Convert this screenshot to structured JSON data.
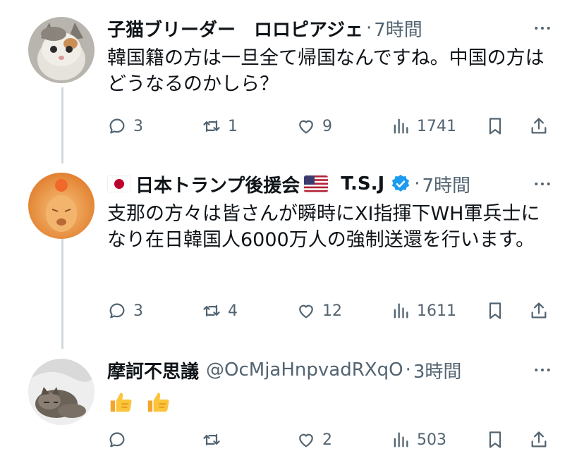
{
  "colors": {
    "muted": "#536471",
    "text": "#0f1419",
    "verified": "#1d9bf0",
    "line": "#cfd9de"
  },
  "tweets": [
    {
      "name": "子猫ブリーダー　ロロピアジェ",
      "handle": "",
      "dot": "·",
      "time": "7時間",
      "text": "韓国籍の方は一旦全て帰国なんですね。中国の方はどうなるのかしら？",
      "replies": "3",
      "reposts": "1",
      "likes": "9",
      "views": "1741",
      "avatar_icon": "kitten-avatar"
    },
    {
      "name_pre_flag_icon": "japan-flag-icon",
      "name": "日本トランプ後援会",
      "name_post_flag_icon": "us-flag-icon",
      "name_suffix": "T.S.J",
      "verified_icon": "verified-badge-icon",
      "dot": "·",
      "time": "7時間",
      "text": "支那の方々は皆さんが瞬時にXI指揮下WH軍兵士になり在日韓国人6000万人の強制送還を行います。",
      "replies": "3",
      "reposts": "4",
      "likes": "12",
      "views": "1611",
      "avatar_icon": "lion-avatar"
    },
    {
      "name": "摩訶不思議",
      "handle": "@OcMjaHnpvadRXqO",
      "dot": "·",
      "time": "3時間",
      "text_emoji": [
        "thumbs-up-icon",
        "thumbs-up-icon"
      ],
      "replies": "",
      "reposts": "",
      "likes": "2",
      "views": "503",
      "avatar_icon": "cat-avatar"
    }
  ],
  "icons": {
    "reply": "reply-icon",
    "repost": "repost-icon",
    "like": "heart-icon",
    "views": "views-icon",
    "bookmark": "bookmark-icon",
    "share": "share-icon",
    "more": "more-icon"
  }
}
